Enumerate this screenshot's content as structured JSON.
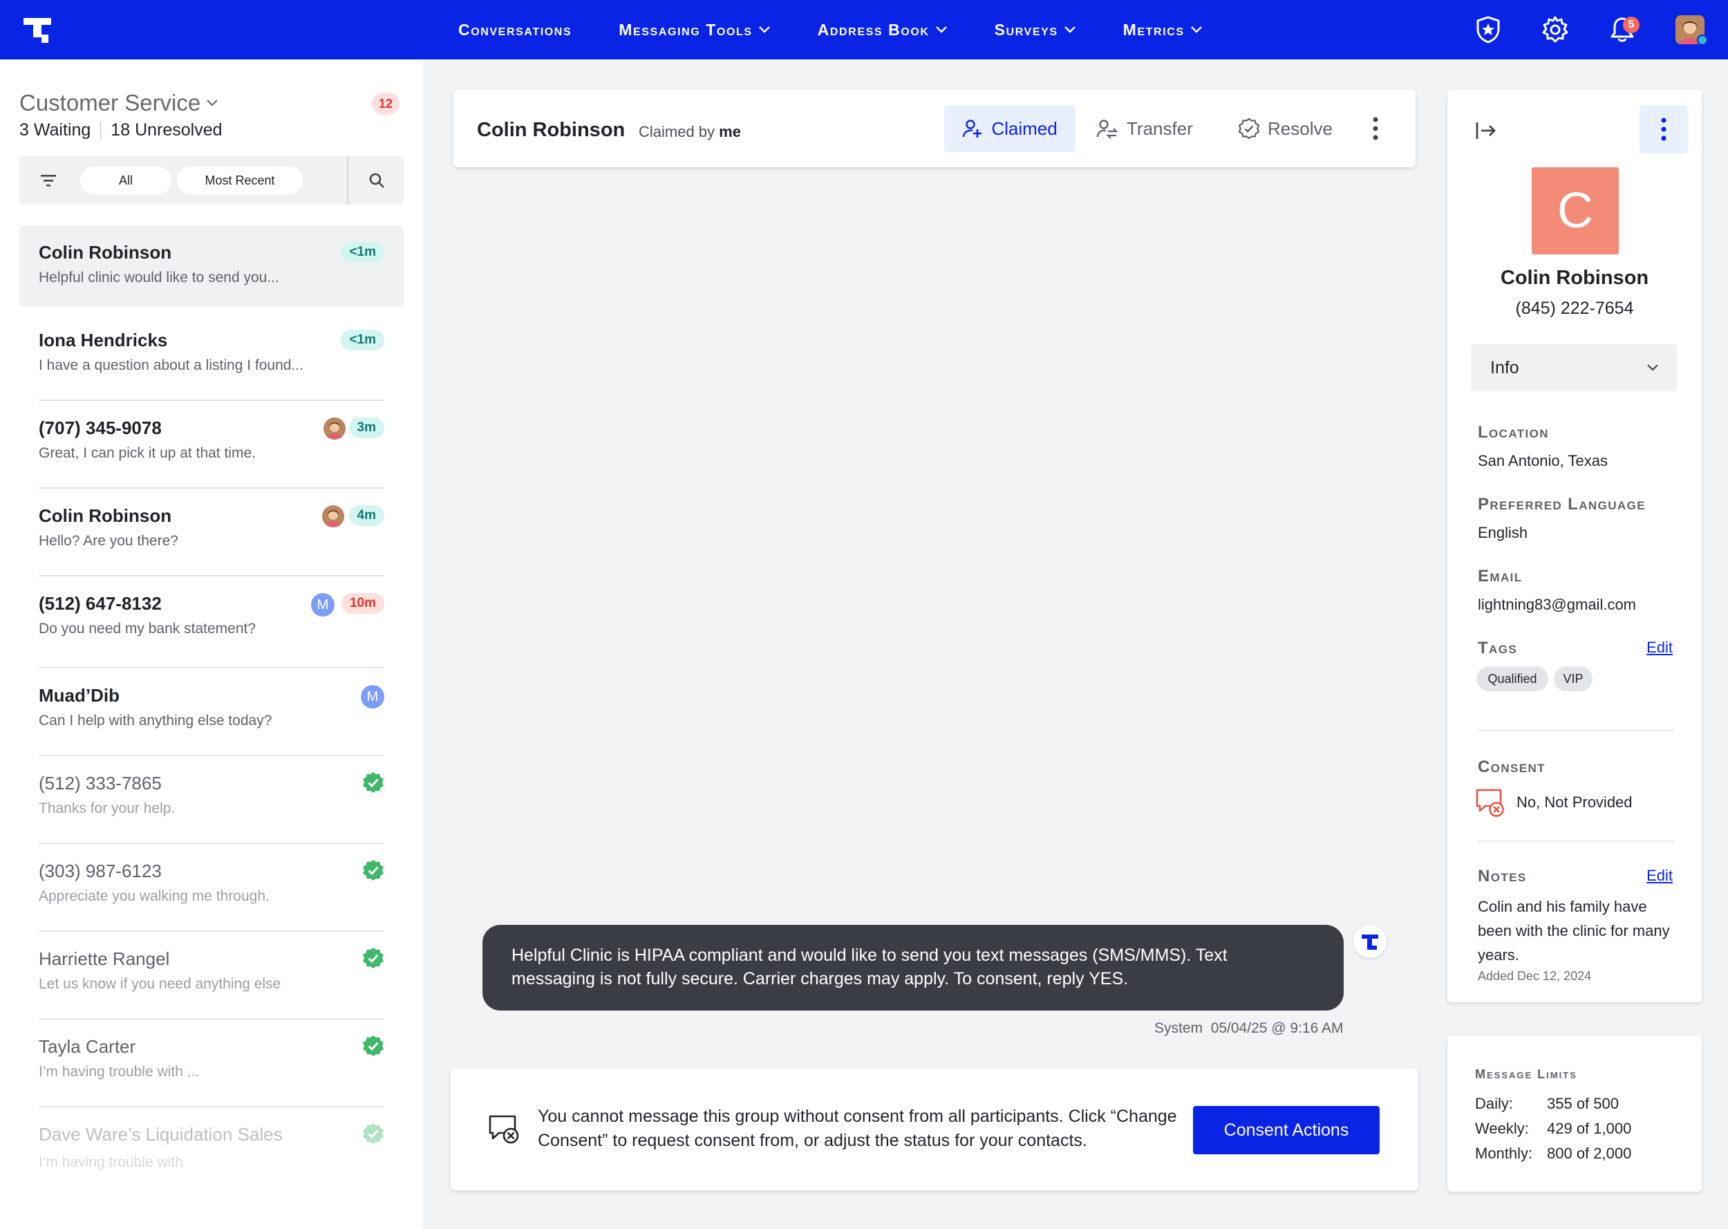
{
  "nav": {
    "links": [
      "Conversations",
      "Messaging Tools",
      "Address Book",
      "Surveys",
      "Metrics"
    ],
    "notification_count": "5",
    "colors": {
      "primary": "#0a24e6",
      "alert": "#f26a5c"
    }
  },
  "queue": {
    "title": "Customer Service",
    "count": "12",
    "waiting_num": "3",
    "waiting_label": "Waiting",
    "unresolved_num": "18",
    "unresolved_label": "Unresolved",
    "filter_all": "All",
    "filter_sort": "Most Recent"
  },
  "conversations": [
    {
      "name": "Colin Robinson",
      "snippet": "Helpful clinic would like to send you...",
      "time": "<1m"
    },
    {
      "name": "Iona Hendricks",
      "snippet": "I have a question about a listing I found...",
      "time": "<1m"
    },
    {
      "name": "(707) 345-9078",
      "snippet": "Great, I can pick it up at that time.",
      "time": "3m"
    },
    {
      "name": "Colin Robinson",
      "snippet": "Hello? Are you there?",
      "time": "4m"
    },
    {
      "name": "(512) 647-8132",
      "snippet": "Do you need my bank statement?",
      "time": "10m",
      "assignee": "M"
    },
    {
      "name": "Muad’Dib",
      "snippet": "Can I help with anything else today?",
      "assignee": "M"
    },
    {
      "name": "(512) 333-7865",
      "snippet": "Thanks for your help."
    },
    {
      "name": "(303) 987-6123",
      "snippet": "Appreciate you walking me through."
    },
    {
      "name": "Harriette Rangel",
      "snippet": "Let us know if you need anything else"
    },
    {
      "name": "Tayla Carter",
      "snippet": "I’m having trouble with ..."
    },
    {
      "name": "Dave Ware’s Liquidation Sales",
      "snippet": "I’m having trouble with"
    }
  ],
  "header": {
    "name": "Colin Robinson",
    "claimed_by_prefix": "Claimed by",
    "claimed_by_user": "me",
    "btn_claimed": "Claimed",
    "btn_transfer": "Transfer",
    "btn_resolve": "Resolve"
  },
  "message": {
    "text": "Helpful Clinic is HIPAA compliant and would like to send you text messages (SMS/MMS). Text messaging is not fully secure. Carrier charges may apply. To consent, reply YES.",
    "sender": "System",
    "timestamp": "05/04/25 @ 9:16 AM"
  },
  "consent_notice": {
    "text": "You cannot message this group without consent from all participants. Click “Change Consent” to request consent from, or adjust the status for your contacts.",
    "button": "Consent Actions"
  },
  "contact": {
    "initial": "C",
    "avatar_color": "#f48b79",
    "name": "Colin Robinson",
    "phone": "(845) 222-7654",
    "section_select": "Info",
    "location_label": "Location",
    "location": "San Antonio, Texas",
    "language_label": "Preferred Language",
    "language": "English",
    "email_label": "Email",
    "email": "lightning83@gmail.com",
    "tags_label": "Tags",
    "tags_edit": "Edit",
    "tags": [
      "Qualified",
      "VIP"
    ],
    "consent_label": "Consent",
    "consent_status": "No, Not Provided",
    "notes_label": "Notes",
    "notes_edit": "Edit",
    "notes": "Colin and his family have been with the clinic for many years.",
    "notes_added": "Added Dec 12, 2024"
  },
  "limits": {
    "title": "Message Limits",
    "daily_label": "Daily:",
    "daily": "355 of 500",
    "weekly_label": "Weekly:",
    "weekly": "429 of 1,000",
    "monthly_label": "Monthly:",
    "monthly": "800 of 2,000"
  }
}
